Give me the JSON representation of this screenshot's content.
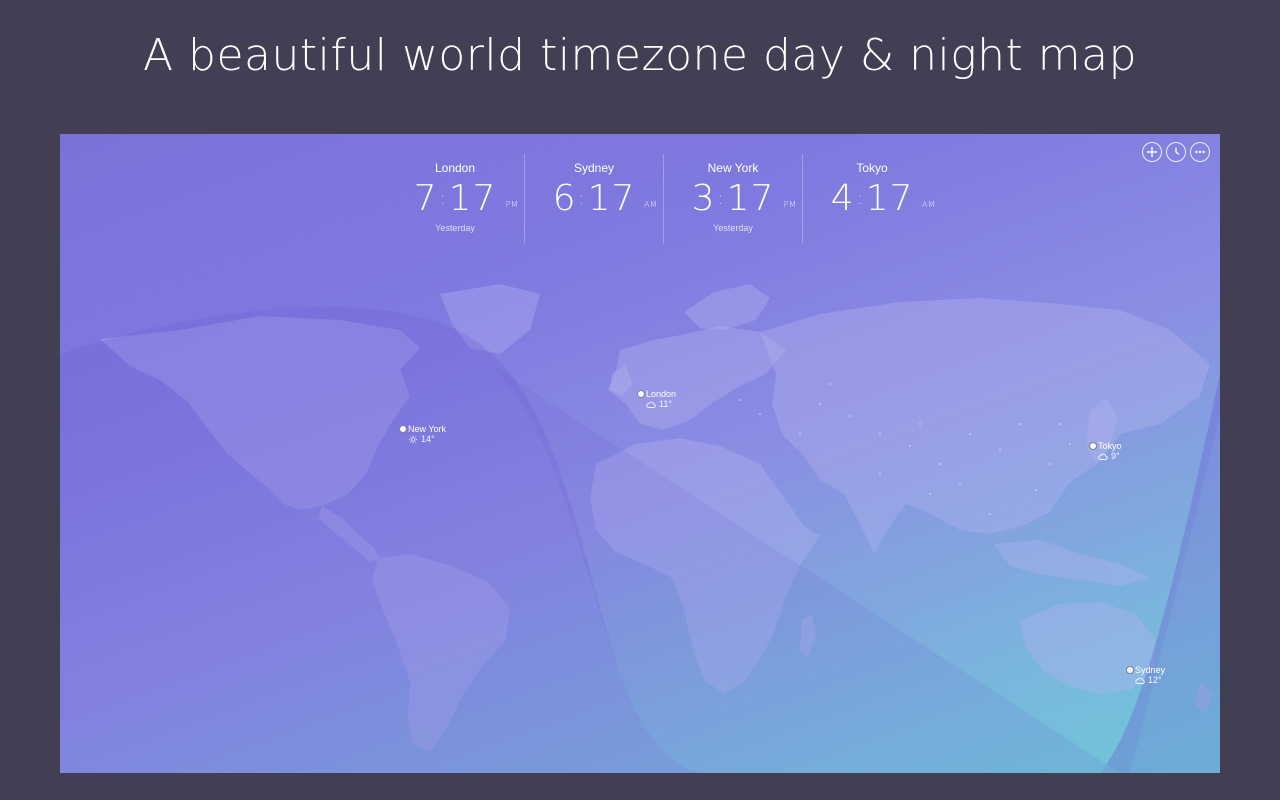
{
  "headline": "A beautiful world timezone day & night map",
  "toolbar": {
    "buttons": [
      {
        "icon": "add-icon"
      },
      {
        "icon": "clock-icon"
      },
      {
        "icon": "more-icon"
      }
    ]
  },
  "clocks": [
    {
      "city": "London",
      "hours": "7",
      "minutes": "17",
      "ampm": "PM",
      "day": "Yesterday"
    },
    {
      "city": "Sydney",
      "hours": "6",
      "minutes": "17",
      "ampm": "AM",
      "day": ""
    },
    {
      "city": "New York",
      "hours": "3",
      "minutes": "17",
      "ampm": "PM",
      "day": "Yesterday"
    },
    {
      "city": "Tokyo",
      "hours": "4",
      "minutes": "17",
      "ampm": "AM",
      "day": ""
    }
  ],
  "map_pins": [
    {
      "city": "London",
      "weather_icon": "cloud-icon",
      "temp": "11°"
    },
    {
      "city": "New York",
      "weather_icon": "sun-icon",
      "temp": "14°"
    },
    {
      "city": "Tokyo",
      "weather_icon": "cloud-icon",
      "temp": "9°"
    },
    {
      "city": "Sydney",
      "weather_icon": "cloud-icon",
      "temp": "12°"
    }
  ],
  "colors": {
    "page_background": "#423f55",
    "map_gradient_start": "#7b72d8",
    "map_gradient_end": "#6ec8d8",
    "night_shade": "#6a5fd6",
    "land": "#a7a6ec"
  }
}
